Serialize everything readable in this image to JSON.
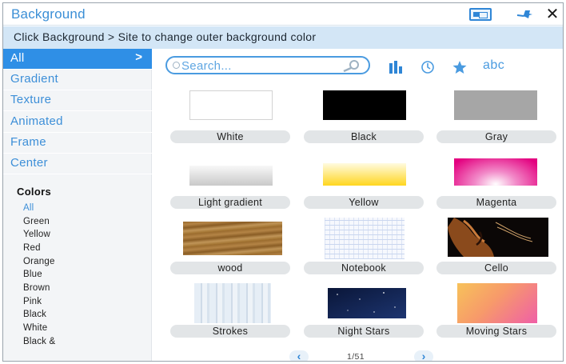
{
  "window": {
    "title": "Background",
    "close_glyph": "✕",
    "icons": [
      "layout-toggle-icon",
      "pin-icon",
      "close-icon"
    ]
  },
  "instruction": "Click Background > Site to change outer background color",
  "sidebar": {
    "categories": [
      {
        "label": "All",
        "active": true
      },
      {
        "label": "Gradient",
        "active": false
      },
      {
        "label": "Texture",
        "active": false
      },
      {
        "label": "Animated",
        "active": false
      },
      {
        "label": "Frame",
        "active": false
      },
      {
        "label": "Center",
        "active": false
      }
    ],
    "active_chevron": ">",
    "colors_heading": "Colors",
    "colors": [
      {
        "label": "All",
        "active": true
      },
      {
        "label": "Green"
      },
      {
        "label": "Yellow"
      },
      {
        "label": "Red"
      },
      {
        "label": "Orange"
      },
      {
        "label": "Blue"
      },
      {
        "label": "Brown"
      },
      {
        "label": "Pink"
      },
      {
        "label": "Black"
      },
      {
        "label": "White"
      },
      {
        "label": "Black &"
      }
    ]
  },
  "search": {
    "placeholder": "Search...",
    "value": ""
  },
  "sort_options": {
    "icons": [
      "bars-sort-icon",
      "clock-icon",
      "star-icon"
    ],
    "abc_label": "abc"
  },
  "tiles": [
    {
      "label": "White"
    },
    {
      "label": "Black"
    },
    {
      "label": "Gray"
    },
    {
      "label": "Light gradient"
    },
    {
      "label": "Yellow"
    },
    {
      "label": "Magenta"
    },
    {
      "label": "wood"
    },
    {
      "label": "Notebook"
    },
    {
      "label": "Cello"
    },
    {
      "label": "Strokes"
    },
    {
      "label": "Night Stars"
    },
    {
      "label": "Moving Stars"
    }
  ],
  "pagination": {
    "prev_glyph": "‹",
    "next_glyph": "›",
    "text": "1/51"
  },
  "colors": {
    "accent": "#2f8fe6",
    "instruction_bg": "#d3e6f6",
    "link": "#3d8fd8"
  }
}
